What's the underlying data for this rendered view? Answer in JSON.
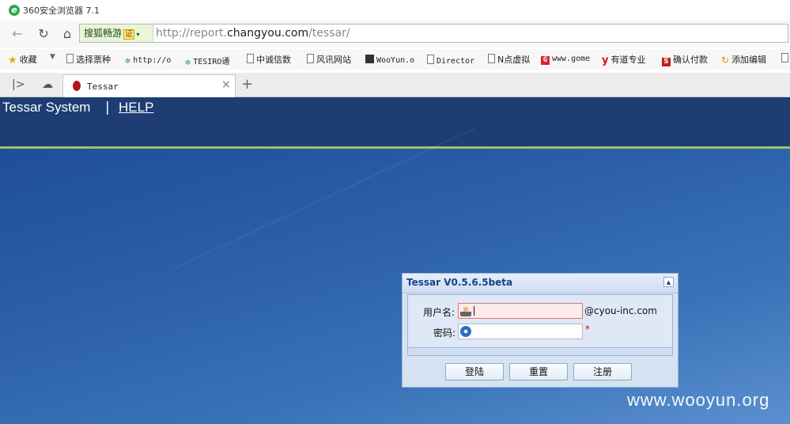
{
  "window": {
    "title": "360安全浏览器 7.1",
    "logo": "e"
  },
  "address_bar": {
    "search_engine": "搜狐畅游",
    "cert_badge": "证",
    "url_prefix": "http://report.",
    "url_domain": "changyou.com",
    "url_suffix": "/tessar/"
  },
  "bookmarks": [
    {
      "label": "收藏",
      "icon": "star-icon"
    },
    {
      "label": "选择票种",
      "icon": "page-icon"
    },
    {
      "label": "http://o",
      "icon": "gear-icon"
    },
    {
      "label": "TESIRO通",
      "icon": "gear-icon"
    },
    {
      "label": "中诚信数",
      "icon": "page-icon"
    },
    {
      "label": "风讯网站",
      "icon": "page-icon"
    },
    {
      "label": "WooYun.o",
      "icon": "wooyun-icon"
    },
    {
      "label": "Director",
      "icon": "page-icon"
    },
    {
      "label": "N点虚拟",
      "icon": "page-icon"
    },
    {
      "label": "www.gome",
      "icon": "gome-icon"
    },
    {
      "label": "有道专业",
      "icon": "youdao-icon"
    },
    {
      "label": "确认付款",
      "icon": "s-icon"
    },
    {
      "label": "添加编辑",
      "icon": "refresh-icon"
    }
  ],
  "tab": {
    "title": "Tessar",
    "close": "×",
    "new": "+"
  },
  "header": {
    "brand": "Tessar System",
    "separator": "|",
    "help": "HELP"
  },
  "login": {
    "title": "Tessar V0.5.6.5beta",
    "username_label": "用户名:",
    "username_value": "",
    "email_suffix": "@cyou-inc.com",
    "password_label": "密码:",
    "password_value": "",
    "required_mark": "*",
    "buttons": {
      "login": "登陆",
      "reset": "重置",
      "register": "注册"
    }
  },
  "watermark": "www.wooyun.org"
}
